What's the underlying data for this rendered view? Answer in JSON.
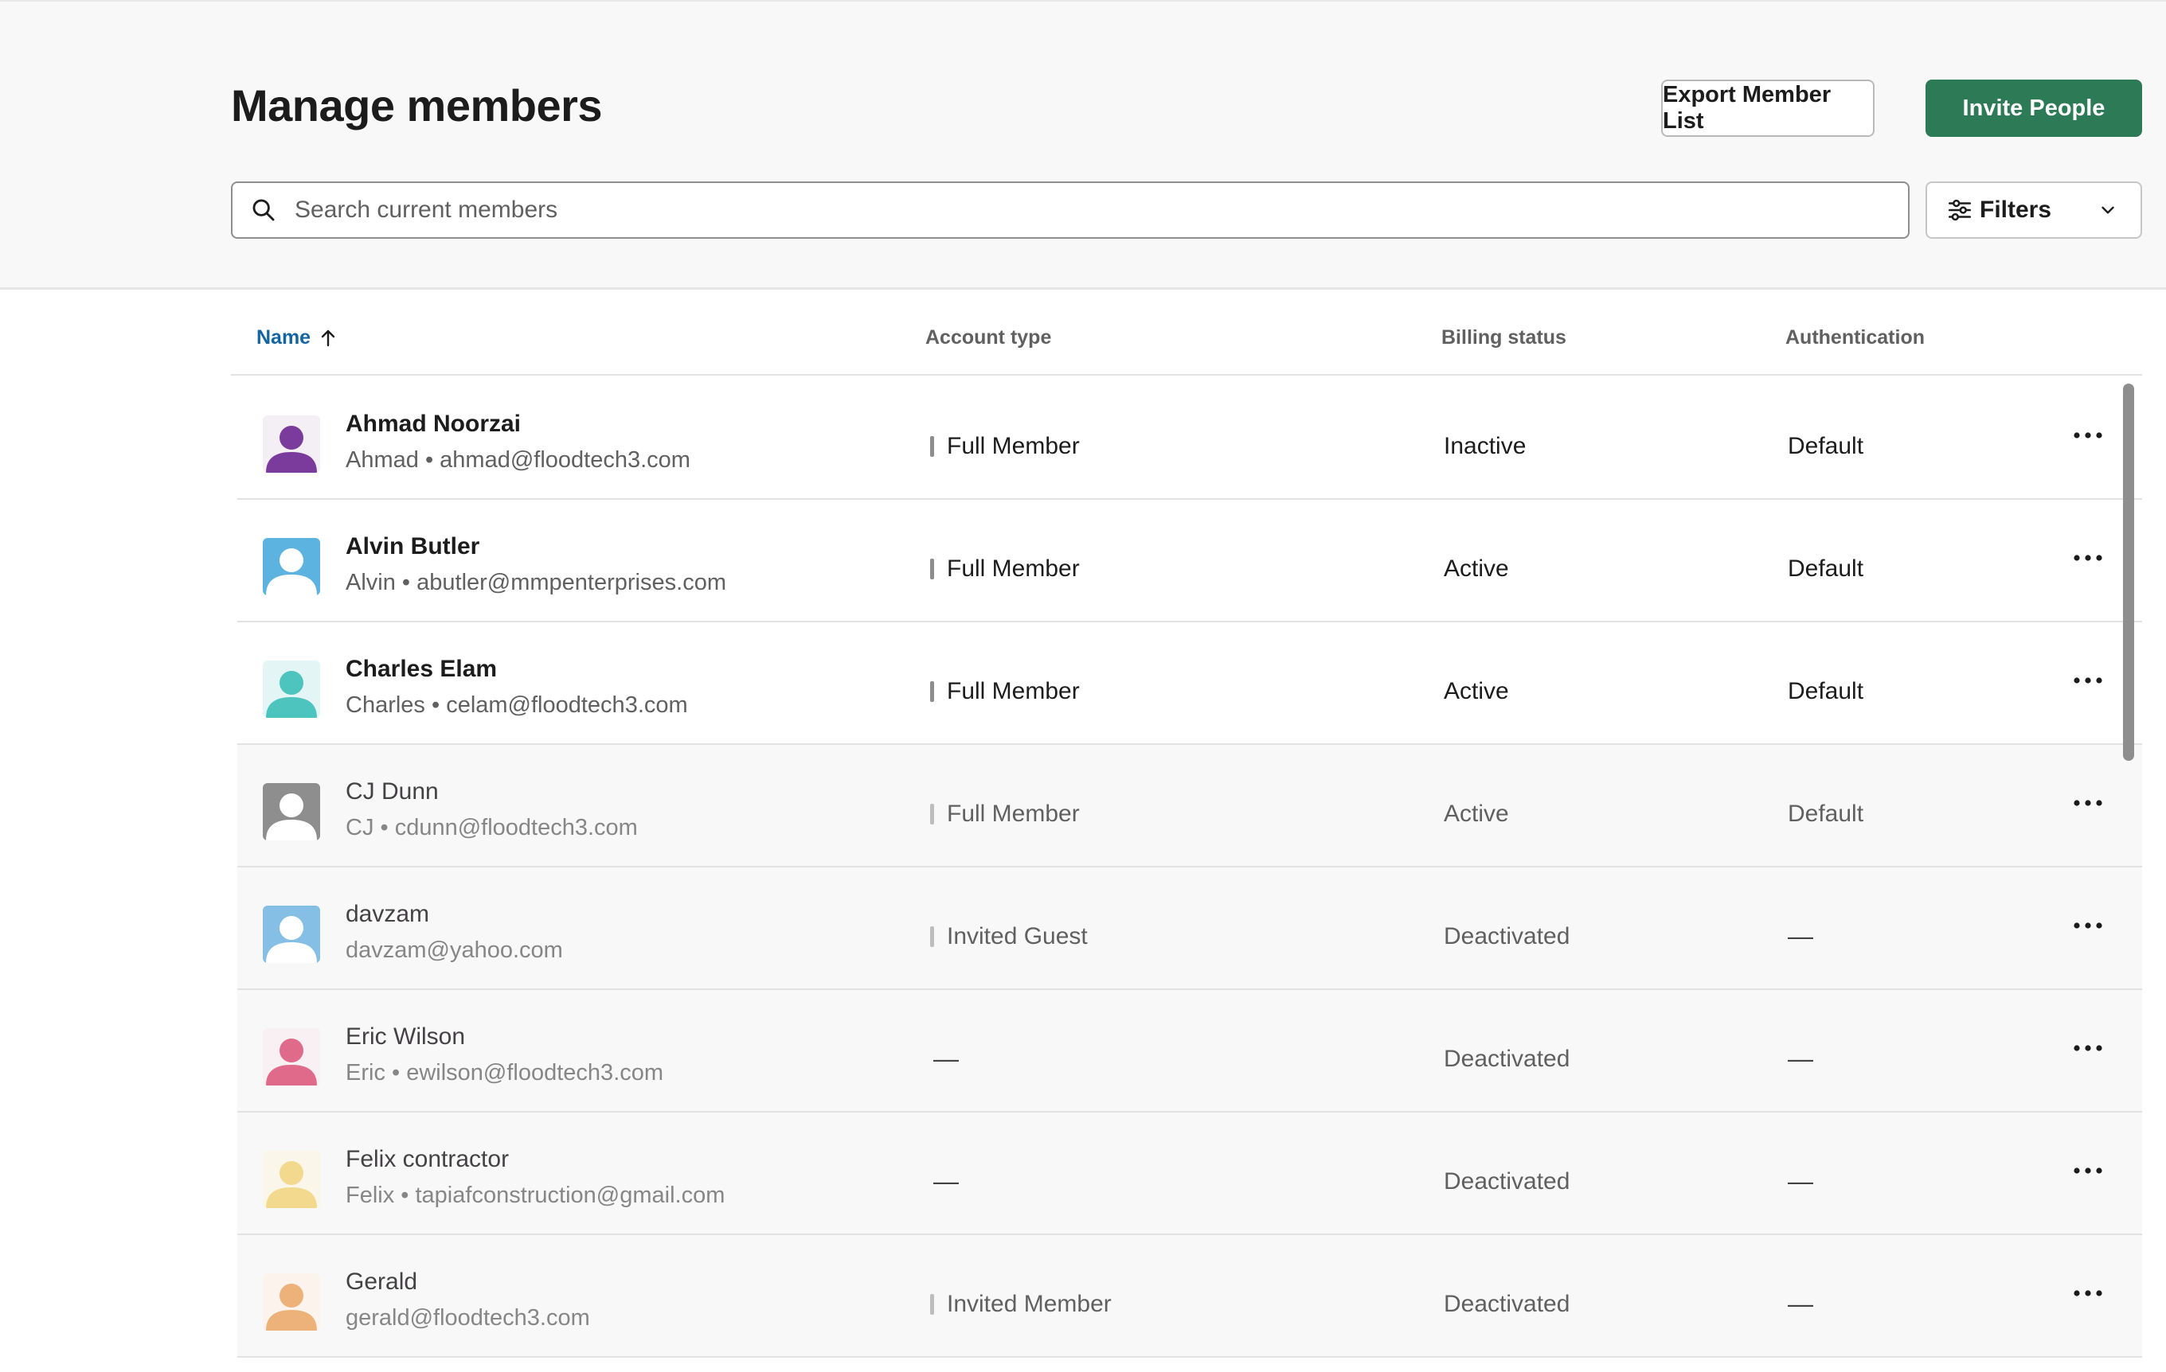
{
  "page": {
    "title": "Manage members",
    "export_label": "Export Member List",
    "invite_label": "Invite People"
  },
  "search": {
    "placeholder": "Search current members",
    "value": ""
  },
  "filters": {
    "label": "Filters"
  },
  "table": {
    "columns": {
      "name": "Name",
      "account_type": "Account type",
      "billing_status": "Billing status",
      "authentication": "Authentication"
    },
    "sort": {
      "column": "Name",
      "direction": "ascending"
    },
    "rows": [
      {
        "name": "Ahmad Noorzai",
        "sub": "Ahmad • ahmad@floodtech3.com",
        "account_type": "Full Member",
        "billing": "Inactive",
        "auth": "Default",
        "avatar_bg": "#f3eff5",
        "avatar_fg": "#7b3b9c"
      },
      {
        "name": "Alvin Butler",
        "sub": "Alvin • abutler@mmpenterprises.com",
        "account_type": "Full Member",
        "billing": "Active",
        "auth": "Default",
        "avatar_bg": "#5cb3e0",
        "avatar_fg": "#ffffff"
      },
      {
        "name": "Charles Elam",
        "sub": "Charles • celam@floodtech3.com",
        "account_type": "Full Member",
        "billing": "Active",
        "auth": "Default",
        "avatar_bg": "#e3f5f4",
        "avatar_fg": "#4dc4bd"
      },
      {
        "name": "CJ Dunn",
        "sub": "CJ • cdunn@floodtech3.com",
        "account_type": "Full Member",
        "billing": "Active",
        "auth": "Default",
        "avatar_bg": "#8e8e8e",
        "avatar_fg": "#ffffff"
      },
      {
        "name": "davzam",
        "sub": "davzam@yahoo.com",
        "account_type": "Invited Guest",
        "billing": "Deactivated",
        "auth": "—",
        "avatar_bg": "#86bfe6",
        "avatar_fg": "#ffffff"
      },
      {
        "name": "Eric Wilson",
        "sub": "Eric • ewilson@floodtech3.com",
        "account_type": "—",
        "billing": "Deactivated",
        "auth": "—",
        "avatar_bg": "#f8f0f2",
        "avatar_fg": "#df6a89"
      },
      {
        "name": "Felix contractor",
        "sub": "Felix • tapiafconstruction@gmail.com",
        "account_type": "—",
        "billing": "Deactivated",
        "auth": "—",
        "avatar_bg": "#fbf6ea",
        "avatar_fg": "#f2d98d"
      },
      {
        "name": "Gerald",
        "sub": "gerald@floodtech3.com",
        "account_type": "Invited Member",
        "billing": "Deactivated",
        "auth": "—",
        "avatar_bg": "#fbf3ec",
        "avatar_fg": "#ecb27a"
      }
    ]
  },
  "icons": {
    "search": "search-icon",
    "filters": "sliders-icon",
    "chevron": "chevron-down-icon",
    "sort": "arrow-up-icon",
    "more": "more-horizontal-icon",
    "avatar": "person-icon"
  },
  "colors": {
    "primary": "#2d7a56",
    "link": "#1264a3",
    "header_bg": "#f8f8f8"
  }
}
